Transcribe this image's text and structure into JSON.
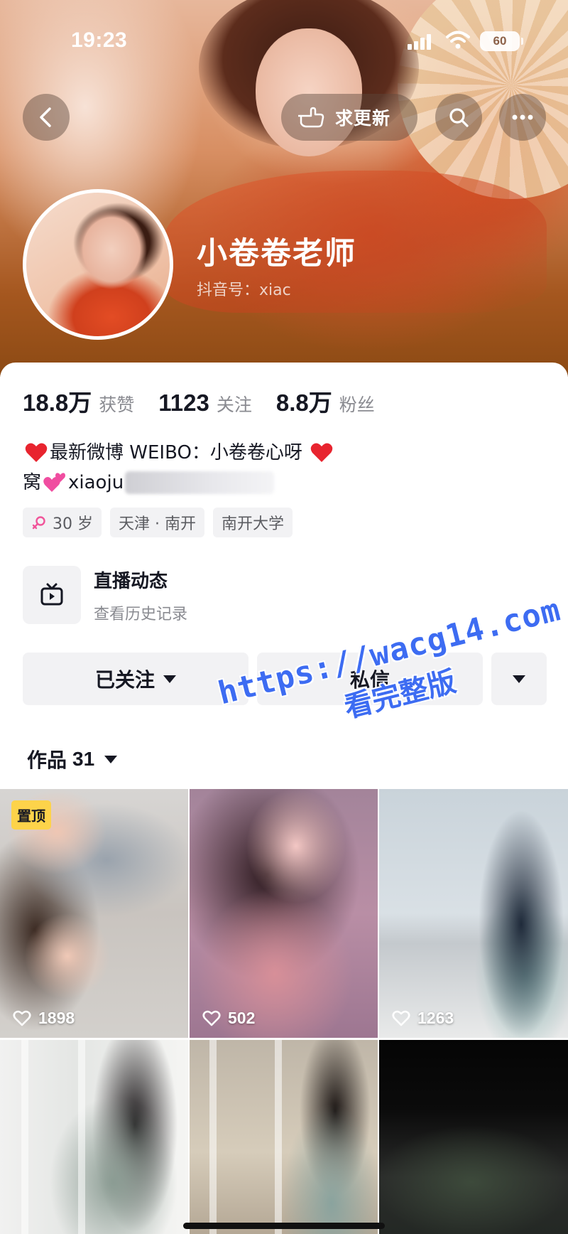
{
  "status_bar": {
    "time": "19:23",
    "battery": "60"
  },
  "header": {
    "update_button_label": "求更新"
  },
  "profile": {
    "nickname": "小卷卷老师",
    "douyin_id_label": "抖音号：",
    "douyin_id_value": "xiac"
  },
  "stats": [
    {
      "value": "18.8万",
      "label": "获赞"
    },
    {
      "value": "1123",
      "label": "关注"
    },
    {
      "value": "8.8万",
      "label": "粉丝"
    }
  ],
  "bio": {
    "line1": "最新微博 WEIBO：小卷卷心呀",
    "line2_prefix": "窝",
    "line2_text": "xiaoju"
  },
  "tags": {
    "age": "30 岁",
    "location": "天津 · 南开",
    "school": "南开大学"
  },
  "live": {
    "title": "直播动态",
    "subtitle": "查看历史记录"
  },
  "actions": {
    "follow_label": "已关注",
    "message_label": "私信"
  },
  "works": {
    "label": "作品",
    "count": "31"
  },
  "videos": [
    {
      "likes": "1898",
      "badge": "置顶"
    },
    {
      "likes": "502"
    },
    {
      "likes": "1263"
    },
    {
      "likes": ""
    },
    {
      "likes": ""
    },
    {
      "likes": ""
    }
  ],
  "watermark": {
    "url": "https://wacg14.com",
    "subtitle": "看完整版"
  },
  "colors": {
    "accent_watermark": "#3d6cf2",
    "pin_badge": "#fdd34a",
    "heart": "#e8242f"
  }
}
